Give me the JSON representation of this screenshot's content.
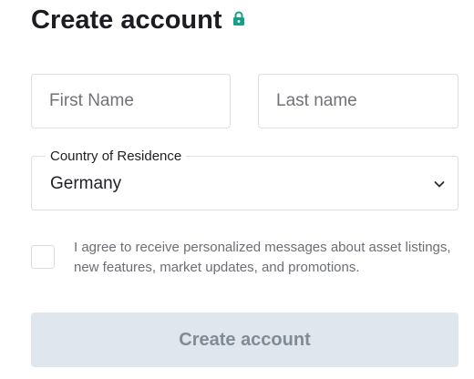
{
  "header": {
    "title": "Create account",
    "lock_icon": "lock-icon",
    "lock_color": "#17a085"
  },
  "form": {
    "first_name": {
      "placeholder": "First Name",
      "value": ""
    },
    "last_name": {
      "placeholder": "Last name",
      "value": ""
    },
    "country": {
      "label": "Country of Residence",
      "selected": "Germany",
      "icon": "chevron-down-icon"
    },
    "consent": {
      "checked": false,
      "text": "I agree to receive personalized messages about asset listings, new features, market updates, and promotions."
    },
    "submit": {
      "label": "Create account",
      "disabled": true
    }
  },
  "colors": {
    "border": "#dcdfe3",
    "submit_bg": "#dfe6ed",
    "submit_text": "#808b96",
    "muted_text": "#6c6f75"
  }
}
